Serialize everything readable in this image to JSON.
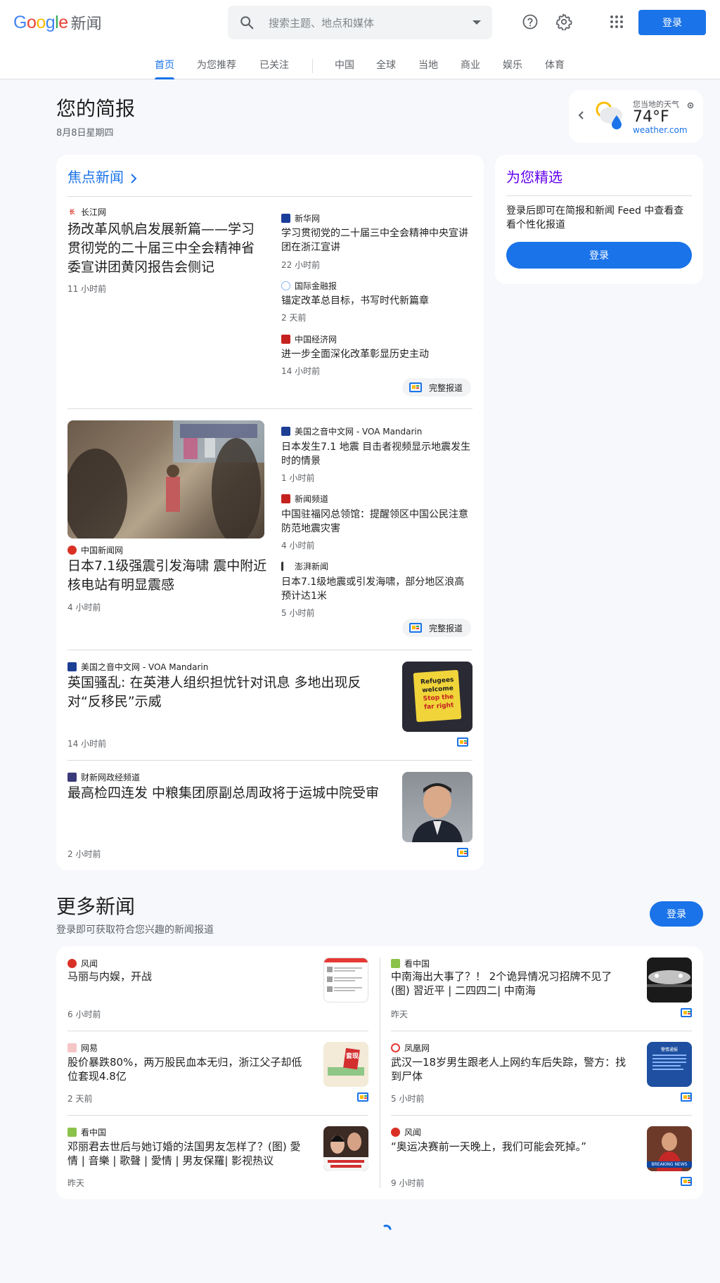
{
  "header": {
    "logo_google": "Google",
    "logo_news": "新闻",
    "search_placeholder": "搜索主题、地点和媒体",
    "signin": "登录"
  },
  "tabs": [
    "首页",
    "为您推荐",
    "已关注",
    "中国",
    "全球",
    "当地",
    "商业",
    "娱乐",
    "体育"
  ],
  "briefing": {
    "title": "您的简报",
    "date": "8月8日星期四"
  },
  "weather": {
    "label": "您当地的天气",
    "temp": "74°F",
    "source": "weather.com"
  },
  "top_stories": {
    "title": "焦点新闻",
    "full_coverage": "完整报道",
    "cluster1": {
      "main": {
        "source": "长江网",
        "headline": "扬改革风帆启发展新篇——学习贯彻党的二十届三中全会精神省委宣讲团黄冈报告会侧记",
        "time": "11 小时前"
      },
      "side": [
        {
          "source": "新华网",
          "headline": "学习贯彻党的二十届三中全会精神中央宣讲团在浙江宣讲",
          "time": "22 小时前"
        },
        {
          "source": "国际金融报",
          "headline": "锚定改革总目标，书写时代新篇章",
          "time": "2 天前"
        },
        {
          "source": "中国经济网",
          "headline": "进一步全面深化改革彰显历史主动",
          "time": "14 小时前"
        }
      ]
    },
    "cluster2": {
      "main": {
        "source": "中国新闻网",
        "headline": "日本7.1级强震引发海啸 震中附近核电站有明显震感",
        "time": "4 小时前"
      },
      "side": [
        {
          "source": "美国之音中文网 - VOA Mandarin",
          "headline": "日本发生7.1 地震 目击者视频显示地震发生时的情景",
          "time": "1 小时前"
        },
        {
          "source": "新闻频道",
          "headline": "中国驻福冈总领馆：提醒领区中国公民注意防范地震灾害",
          "time": "4 小时前"
        },
        {
          "source": "澎湃新闻",
          "headline": "日本7.1级地震或引发海啸，部分地区浪高预计达1米",
          "time": "5 小时前"
        }
      ]
    },
    "single1": {
      "source": "美国之音中文网 - VOA Mandarin",
      "headline": "英国骚乱: 在英港人组织担忧针对讯息 多地出现反对“反移民”示威",
      "time": "14 小时前",
      "thumb_text": [
        "Refugees",
        "welcome",
        "Stop the",
        "far right"
      ]
    },
    "single2": {
      "source": "财新网政经频道",
      "headline": "最高检四连发 中粮集团原副总周政将于运城中院受审",
      "time": "2 小时前"
    }
  },
  "picks": {
    "title": "为您精选",
    "desc": "登录后即可在简报和新闻 Feed 中查看查看个性化报道",
    "button": "登录"
  },
  "more": {
    "title": "更多新闻",
    "subtitle": "登录即可获取符合您兴趣的新闻报道",
    "button": "登录",
    "items": [
      {
        "source": "风闻",
        "headline": "马丽与内娱，开战",
        "time": "6 小时前"
      },
      {
        "source": "看中国",
        "headline": "中南海出大事了？！ 2个诡异情况习招牌不见了(图) 習近平 | 二四四二| 中南海",
        "time": "昨天"
      },
      {
        "source": "网易",
        "headline": "股价暴跌80%，两万股民血本无归，浙江父子却低位套现4.8亿",
        "time": "2 天前",
        "thumb_text": "套现"
      },
      {
        "source": "凤凰网",
        "headline": "武汉一18岁男生跟老人上网约车后失踪，警方：找到尸体",
        "time": "5 小时前",
        "thumb_text": "警情通报"
      },
      {
        "source": "看中国",
        "headline": "邓丽君去世后与她订婚的法国男友怎样了？(图) 愛情 | 音樂 | 歌聲 | 愛情 | 男友保羅| 影视热议",
        "time": "昨天"
      },
      {
        "source": "风闻",
        "headline": "“奥运决赛前一天晚上，我们可能会死掉。”",
        "time": "9 小时前",
        "thumb_text": "BREAKING NEWS"
      }
    ]
  },
  "colors": {
    "accent": "#1a73e8",
    "picks_title": "#6200ee"
  }
}
